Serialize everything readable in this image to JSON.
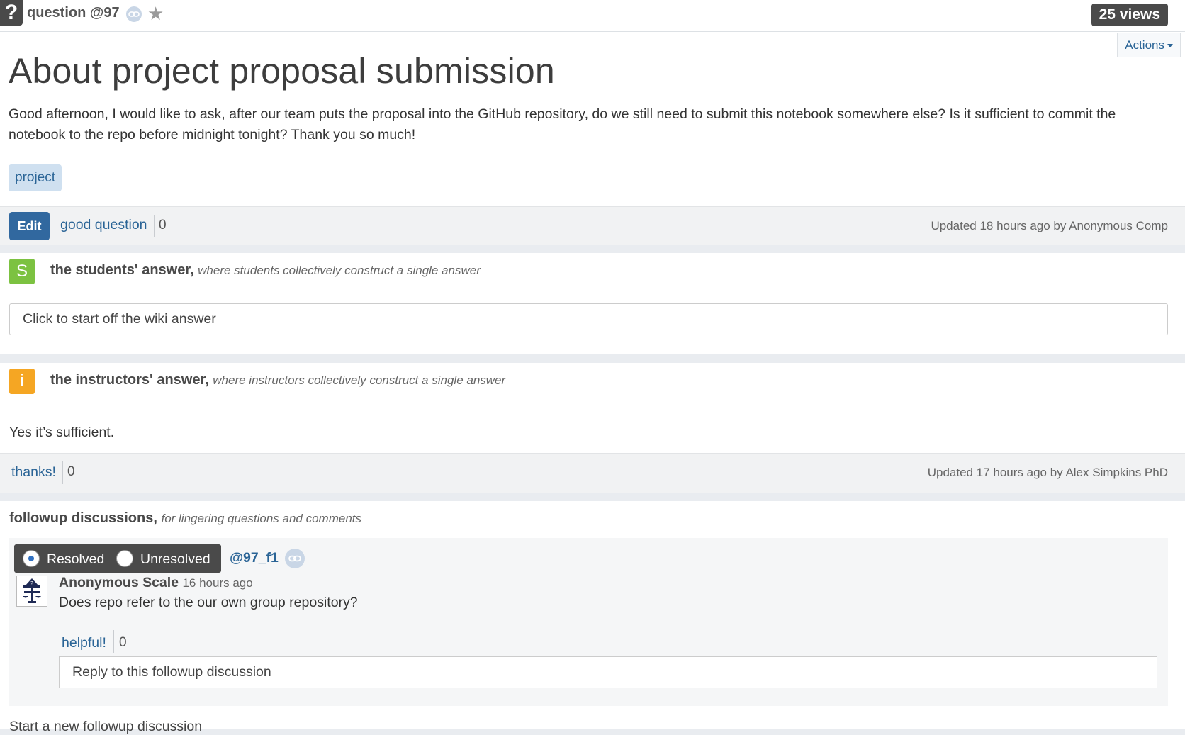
{
  "header": {
    "label": "question @97",
    "views": "25 views",
    "actions_label": "Actions"
  },
  "question": {
    "title": "About project proposal submission",
    "body": "Good afternoon, I would like to ask, after our team puts the proposal into the GitHub repository, do we still need to submit this notebook somewhere else? Is it sufficient to commit the notebook to the repo before midnight tonight? Thank you so much!",
    "tag": "project",
    "edit_label": "Edit",
    "good_question_label": "good question",
    "good_question_count": "0",
    "updated": "Updated 18 hours ago by Anonymous Comp"
  },
  "students_answer": {
    "badge": "S",
    "title": "the students' answer,",
    "subtitle": "where students collectively construct a single answer",
    "placeholder": "Click to start off the wiki answer"
  },
  "instructors_answer": {
    "badge": "i",
    "title": "the instructors' answer,",
    "subtitle": "where instructors collectively construct a single answer",
    "body": "Yes it’s sufficient.",
    "thanks_label": "thanks!",
    "thanks_count": "0",
    "updated": "Updated 17 hours ago by Alex Simpkins PhD"
  },
  "followups": {
    "title": "followup discussions,",
    "subtitle": "for lingering questions and comments",
    "resolved_label": "Resolved",
    "unresolved_label": "Unresolved",
    "id": "@97_f1",
    "author": "Anonymous Scale",
    "time": "16 hours ago",
    "text": "Does repo refer to the our own group repository?",
    "helpful_label": "helpful!",
    "helpful_count": "0",
    "reply_placeholder": "Reply to this followup discussion",
    "new_followup": "Start a new followup discussion"
  }
}
